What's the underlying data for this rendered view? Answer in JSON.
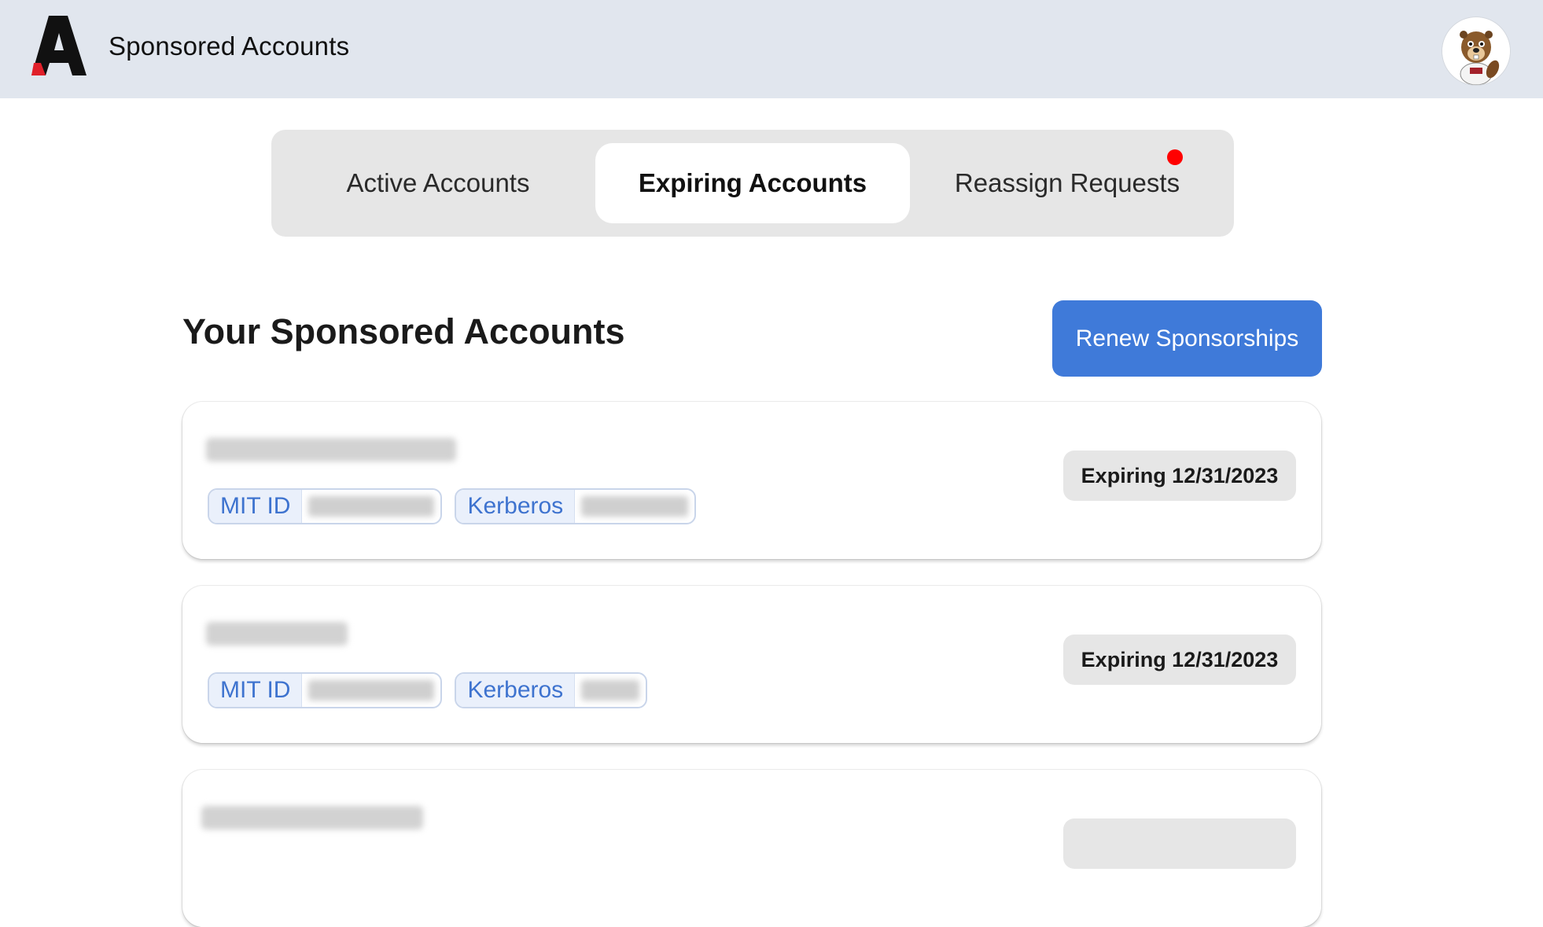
{
  "header": {
    "title": "Sponsored Accounts",
    "logo_icon": "app-logo-a-icon",
    "avatar_icon": "beaver-mascot-avatar"
  },
  "tabs": [
    {
      "label": "Active Accounts",
      "active": false
    },
    {
      "label": "Expiring Accounts",
      "active": true
    },
    {
      "label": "Reassign Requests",
      "active": false,
      "has_notification": true
    }
  ],
  "section": {
    "title": "Your Sponsored Accounts",
    "renew_label": "Renew Sponsorships"
  },
  "accounts": [
    {
      "mit_id_label": "MIT ID",
      "kerberos_label": "Kerberos",
      "status": "Expiring 12/31/2023"
    },
    {
      "mit_id_label": "MIT ID",
      "kerberos_label": "Kerberos",
      "status": "Expiring 12/31/2023"
    },
    {}
  ],
  "colors": {
    "header_bg": "#e1e6ee",
    "accent": "#3f7ad9",
    "notification": "#ff0000",
    "chip_text": "#3e73cf"
  }
}
